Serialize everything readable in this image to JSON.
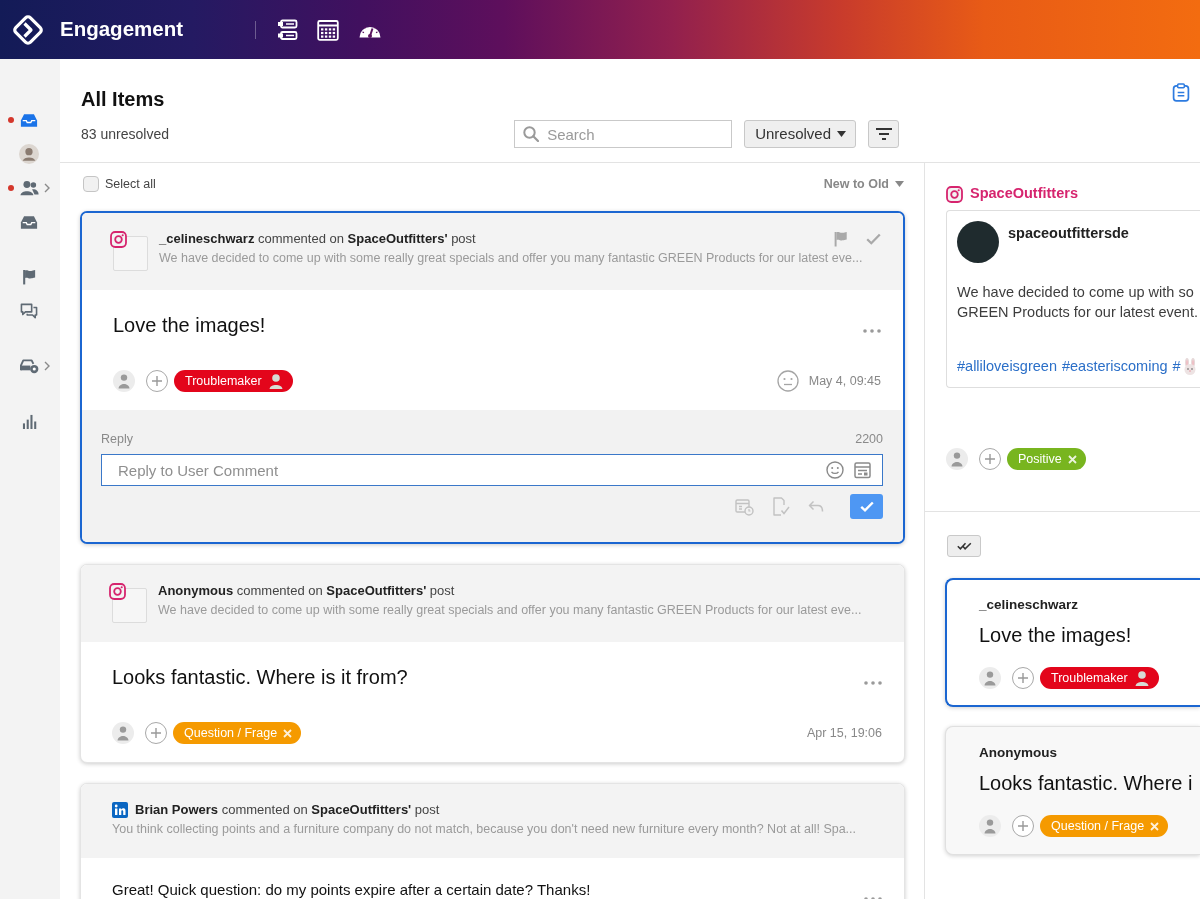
{
  "topbar": {
    "title": "Engagement"
  },
  "sidebar": {
    "groups": [
      {
        "items": [
          {
            "kind": "inbox",
            "selected": true,
            "notification": true,
            "submenu": false
          },
          {
            "kind": "avatar",
            "selected": false,
            "notification": false,
            "submenu": false
          },
          {
            "kind": "people",
            "selected": false,
            "notification": true,
            "submenu": true
          },
          {
            "kind": "inbox",
            "selected": false,
            "notification": false,
            "submenu": false
          }
        ]
      },
      {
        "items": [
          {
            "kind": "flag",
            "selected": false,
            "notification": false,
            "submenu": false
          },
          {
            "kind": "chat",
            "selected": false,
            "notification": false,
            "submenu": false
          }
        ]
      },
      {
        "items": [
          {
            "kind": "car",
            "selected": false,
            "notification": false,
            "submenu": true
          }
        ]
      },
      {
        "items": [
          {
            "kind": "chart",
            "selected": false,
            "notification": false,
            "submenu": false
          }
        ]
      }
    ]
  },
  "header": {
    "title": "All Items",
    "summary": "83 unresolved",
    "search": {
      "placeholder": "Search"
    },
    "status_filter": {
      "label": "Unresolved"
    }
  },
  "list": {
    "select_all": {
      "label": "Select all",
      "checked": false
    },
    "sort": {
      "label": "New to Old"
    },
    "items": [
      {
        "kind": "instagram",
        "avatar_placeholder": true,
        "selected": true,
        "headline": "**_celineschwarz** commented on **SpaceOutfitters'** post",
        "preview": "We have decided to come up with some really great specials and offer you many fantastic GREEN Products for our latest eve...",
        "message": "Love the images!",
        "tags": [
          {
            "label": "Troublemaker",
            "kind": "segment",
            "color": "#e3051b"
          }
        ],
        "time": "May 4, 09:45",
        "reply": {
          "label": "Reply",
          "counter": "2200",
          "placeholder": "Reply to User Comment"
        }
      },
      {
        "kind": "instagram",
        "avatar_placeholder": true,
        "selected": false,
        "headline": "**Anonymous** commented on **SpaceOutfitters'** post",
        "preview": "We have decided to come up with some really great specials and offer you many fantastic GREEN Products for our latest eve...",
        "message": "Looks fantastic. Where is it from?",
        "tags": [
          {
            "label": "Question / Frage",
            "kind": "removable",
            "color": "#f59a00"
          }
        ],
        "time": "Apr 15, 19:06"
      },
      {
        "kind": "linkedin",
        "avatar_placeholder": false,
        "selected": false,
        "headline": "**Brian Powers** commented on **SpaceOutfitters'** post",
        "preview": "You think collecting points and a furniture company do not match, because you don't need new furniture every month? Not at all! Spa...",
        "message": "Great! Quick question: do my points expire after a certain date? Thanks!"
      }
    ]
  },
  "detail": {
    "source": {
      "kind": "instagram",
      "account": "SpaceOutfitters"
    },
    "post": {
      "author": "spaceoutfittersde",
      "lines": [
        "We have decided to come up with so",
        "GREEN Products for our latest event."
      ],
      "hashtags": [
        {
          "text": "#alliloveisgreen",
          "kind": "text"
        },
        {
          "text": "#easteriscoming",
          "kind": "text"
        },
        {
          "text": "#",
          "kind": "emoji"
        }
      ]
    },
    "tags": [
      {
        "label": "Positive",
        "kind": "removable",
        "color": "#78b51f"
      }
    ],
    "thread": [
      {
        "author": "_celineschwarz",
        "message": "Love the images!",
        "selected": true,
        "tags": [
          {
            "label": "Troublemaker",
            "kind": "segment",
            "color": "#e3051b"
          }
        ]
      },
      {
        "author": "Anonymous",
        "message": "Looks fantastic. Where i",
        "selected": false,
        "tags": [
          {
            "label": "Question / Frage",
            "kind": "removable",
            "color": "#f59a00"
          }
        ]
      }
    ]
  }
}
